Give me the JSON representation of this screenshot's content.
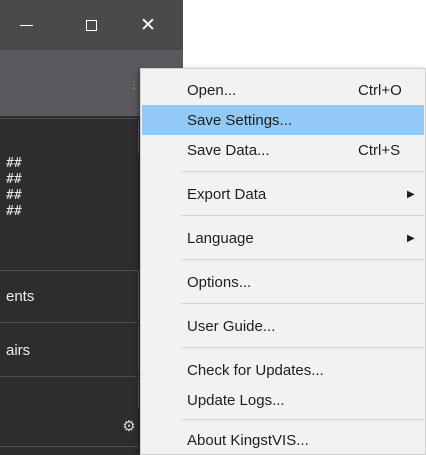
{
  "window": {
    "minimize_icon": "minimize-icon",
    "maximize_icon": "maximize-icon",
    "close_glyph": "✕",
    "hash_lines": [
      "##",
      "##",
      "##",
      "##"
    ],
    "left_items": [
      "ents",
      "airs"
    ],
    "gear_glyph": "⚙"
  },
  "menu": {
    "highlight_color": "#91c9f7",
    "items": [
      {
        "label": "Open...",
        "shortcut": "Ctrl+O"
      },
      {
        "label": "Save Settings...",
        "shortcut": "",
        "highlighted": true
      },
      {
        "label": "Save Data...",
        "shortcut": "Ctrl+S"
      },
      {
        "label": "Export Data",
        "submenu": true
      },
      {
        "label": "Language",
        "submenu": true
      },
      {
        "label": "Options..."
      },
      {
        "label": "User Guide..."
      },
      {
        "label": "Check for Updates..."
      },
      {
        "label": "Update Logs..."
      },
      {
        "label": "About KingstVIS..."
      }
    ],
    "submenu_arrow": "▶"
  }
}
